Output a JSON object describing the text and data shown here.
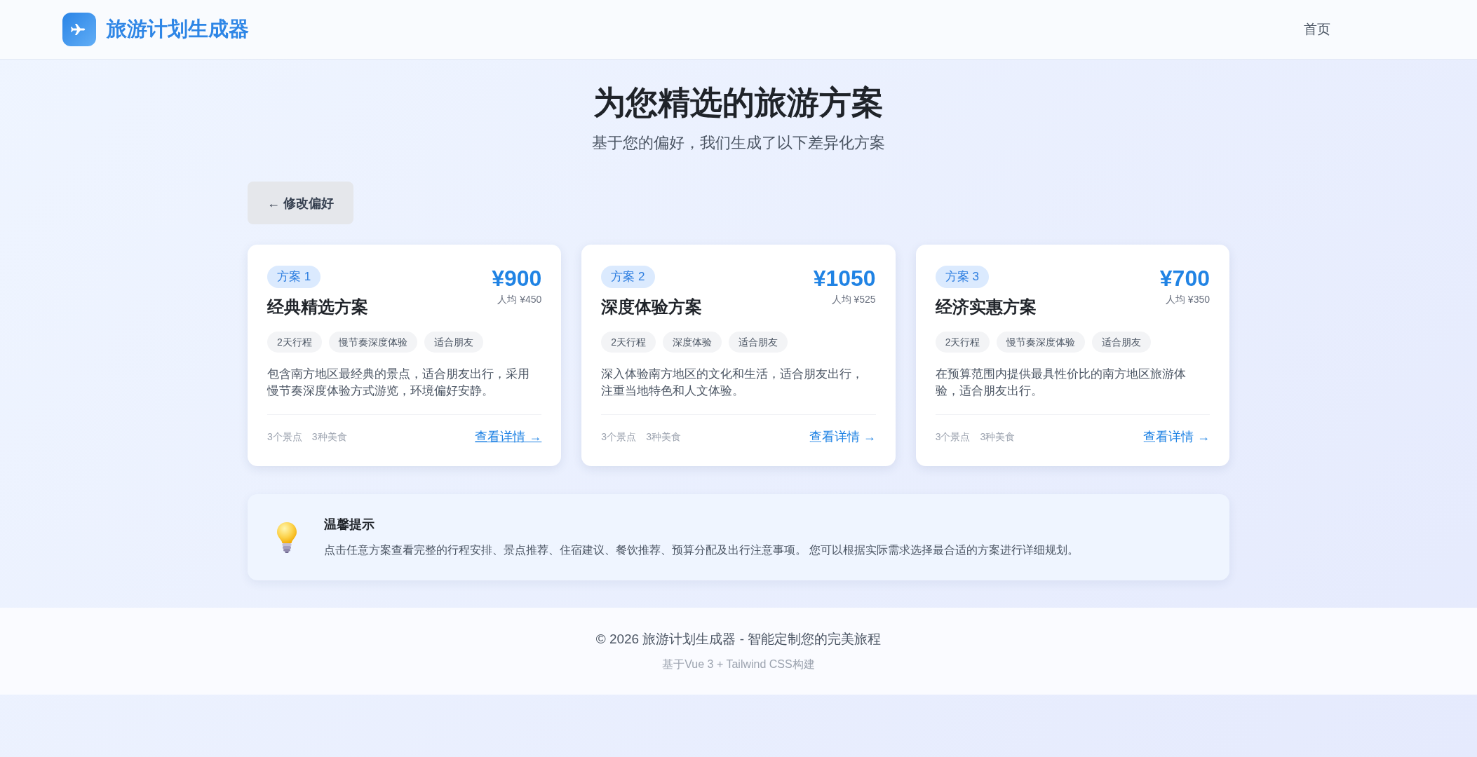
{
  "header": {
    "app_title": "旅游计划生成器",
    "nav": [
      {
        "label": "首页"
      }
    ]
  },
  "hero": {
    "title": "为您精选的旅游方案",
    "subtitle": "基于您的偏好，我们生成了以下差异化方案"
  },
  "back_button": {
    "label": "← 修改偏好"
  },
  "plans": [
    {
      "badge": "方案 1",
      "price": "¥900",
      "per_person": "人均 ¥450",
      "title": "经典精选方案",
      "tags": [
        "2天行程",
        "慢节奏深度体验",
        "适合朋友"
      ],
      "description": "包含南方地区最经典的景点，适合朋友出行，采用慢节奏深度体验方式游览，环境偏好安静。",
      "stats": [
        "3个景点",
        "3种美食"
      ],
      "link": {
        "label": "查看详情 →",
        "hovered": true
      }
    },
    {
      "badge": "方案 2",
      "price": "¥1050",
      "per_person": "人均 ¥525",
      "title": "深度体验方案",
      "tags": [
        "2天行程",
        "深度体验",
        "适合朋友"
      ],
      "description": "深入体验南方地区的文化和生活，适合朋友出行，注重当地特色和人文体验。",
      "stats": [
        "3个景点",
        "3种美食"
      ],
      "link": {
        "label": "查看详情 →",
        "hovered": false
      }
    },
    {
      "badge": "方案 3",
      "price": "¥700",
      "per_person": "人均 ¥350",
      "title": "经济实惠方案",
      "tags": [
        "2天行程",
        "慢节奏深度体验",
        "适合朋友"
      ],
      "description": "在预算范围内提供最具性价比的南方地区旅游体验，适合朋友出行。",
      "stats": [
        "3个景点",
        "3种美食"
      ],
      "link": {
        "label": "查看详情 →",
        "hovered": false
      }
    }
  ],
  "tip": {
    "title": "温馨提示",
    "text": "点击任意方案查看完整的行程安排、景点推荐、住宿建议、餐饮推荐、预算分配及出行注意事项。 您可以根据实际需求选择最合适的方案进行详细规划。"
  },
  "footer": {
    "copyright": "© 2026 旅游计划生成器 - 智能定制您的完美旅程",
    "credit": "基于Vue 3 + Tailwind CSS构建"
  }
}
